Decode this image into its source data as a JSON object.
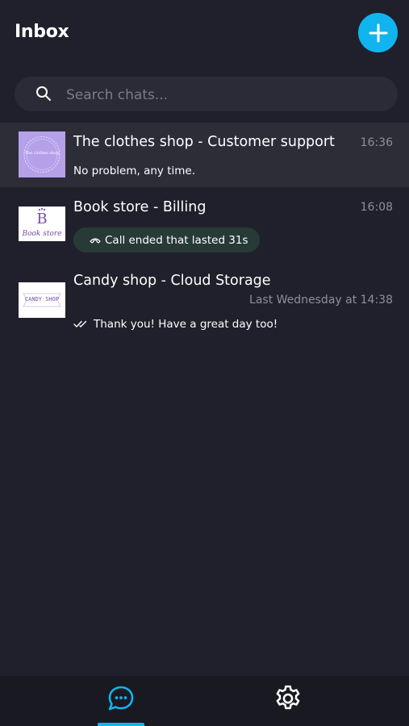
{
  "header": {
    "title": "Inbox",
    "new_chat_icon": "plus-icon"
  },
  "search": {
    "placeholder": "Search chats...",
    "value": "",
    "icon": "search-icon"
  },
  "chats": [
    {
      "name": "The clothes shop - Customer support",
      "time": "16:36",
      "last_message": "No problem, any time.",
      "avatar_text": "The clothes shop",
      "selected": true
    },
    {
      "name": "Book store - Billing",
      "time": "16:08",
      "last_message": "Call ended that lasted 31s",
      "avatar_letter": "B",
      "avatar_text": "Book store",
      "message_type": "call"
    },
    {
      "name": "Candy shop - Cloud Storage",
      "time": "Last Wednesday at 14:38",
      "last_message": "Thank you! Have a great day too!",
      "avatar_text": "CANDY SHOP",
      "message_status": "read-double-check"
    }
  ],
  "bottom_nav": {
    "items": [
      {
        "icon": "chat-bubble-icon",
        "active": true
      },
      {
        "icon": "gear-icon",
        "active": false
      }
    ]
  },
  "colors": {
    "background": "#20202c",
    "accent": "#10b4ee",
    "selected_row": "#2d2d37",
    "call_pill": "#273a35",
    "muted_text": "#8f8f99"
  }
}
